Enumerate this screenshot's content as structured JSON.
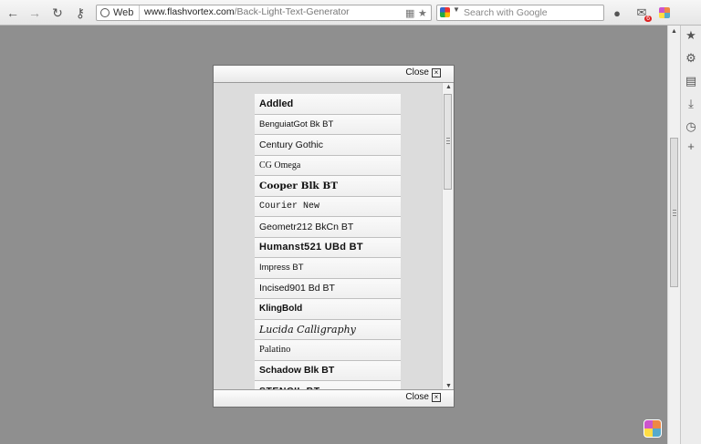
{
  "browser": {
    "web_label": "Web",
    "url_host": "www.flashvortex.com",
    "url_path": "/Back-Light-Text-Generator",
    "search_placeholder": "Search with Google"
  },
  "modal": {
    "close_label": "Close",
    "fonts": [
      "Addled",
      "BenguiatGot Bk BT",
      "Century Gothic",
      "CG Omega",
      "Cooper Blk BT",
      "Courier New",
      "Geometr212 BkCn BT",
      "Humanst521 UBd BT",
      "Impress BT",
      "Incised901 Bd BT",
      "KlingBold",
      "Lucida Calligraphy",
      "Palatino",
      "Schadow Blk BT",
      "STENCIL BT"
    ]
  },
  "icons": {
    "back": "back-arrow-icon",
    "forward": "forward-arrow-icon",
    "reload": "reload-icon",
    "key": "key-icon",
    "badge_count": "6"
  }
}
